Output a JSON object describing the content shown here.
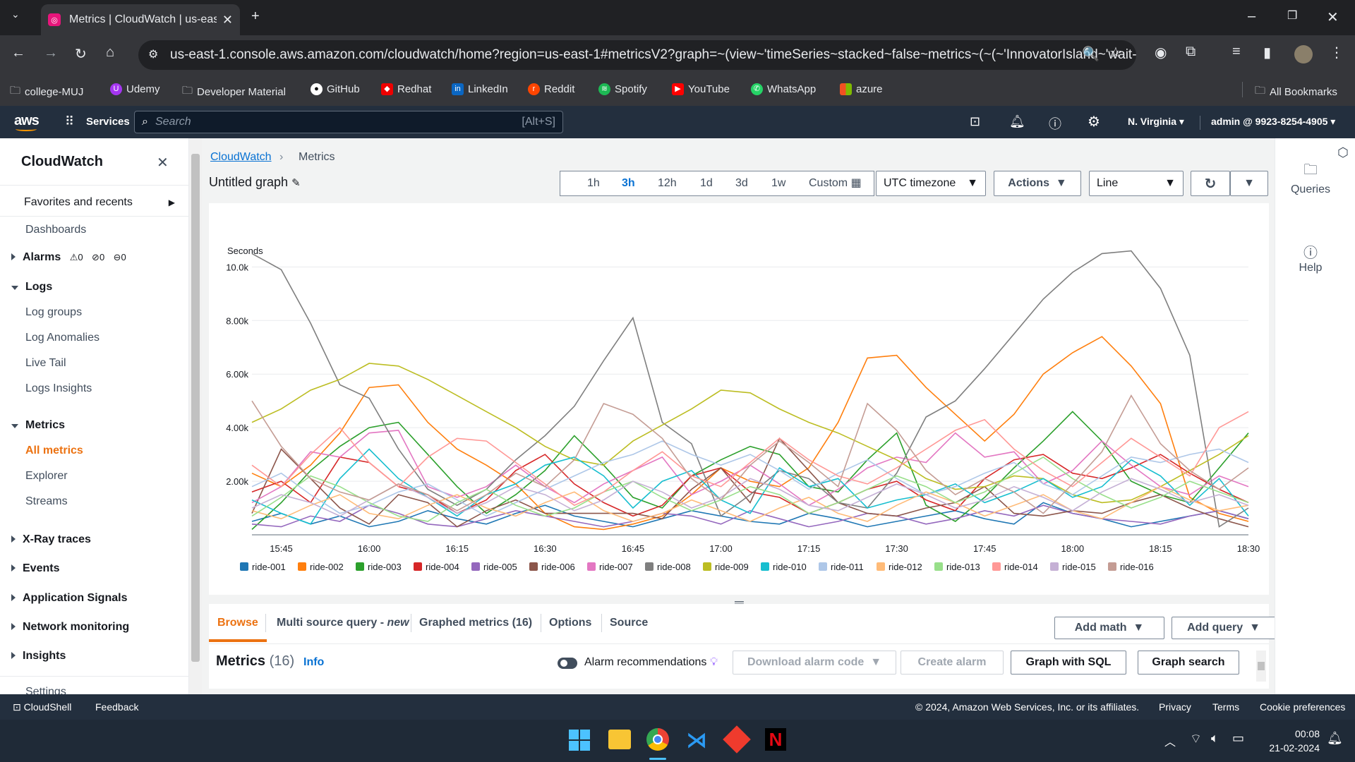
{
  "browser": {
    "tab_title": "Metrics | CloudWatch | us-east-",
    "url": "us-east-1.console.aws.amazon.com/cloudwatch/home?region=us-east-1#metricsV2?graph=~(view~'timeSeries~stacked~false~metrics~(~(~'InnovatorIsland~'wait-...",
    "bookmarks": [
      "college-MUJ",
      "Udemy",
      "Developer Material",
      "GitHub",
      "Redhat",
      "LinkedIn",
      "Reddit",
      "Spotify",
      "YouTube",
      "WhatsApp",
      "azure"
    ],
    "all_bookmarks": "All Bookmarks"
  },
  "aws": {
    "logo": "aws",
    "services": "Services",
    "search_placeholder": "Search",
    "search_shortcut": "[Alt+S]",
    "region": "N. Virginia",
    "account": "admin @ 9923-8254-4905"
  },
  "sidebar": {
    "title": "CloudWatch",
    "favorites": "Favorites and recents",
    "dashboards": "Dashboards",
    "alarms": "Alarms",
    "alarm_counts": [
      "0",
      "0",
      "0"
    ],
    "logs": "Logs",
    "log_items": [
      "Log groups",
      "Log Anomalies",
      "Live Tail",
      "Logs Insights"
    ],
    "metrics": "Metrics",
    "metric_items": [
      "All metrics",
      "Explorer",
      "Streams"
    ],
    "sections": [
      "X-Ray traces",
      "Events",
      "Application Signals",
      "Network monitoring",
      "Insights"
    ],
    "settings": "Settings"
  },
  "main": {
    "breadcrumb_root": "CloudWatch",
    "breadcrumb_current": "Metrics",
    "graph_title": "Untitled graph",
    "time_ranges": [
      "1h",
      "3h",
      "12h",
      "1d",
      "3d",
      "1w"
    ],
    "active_range": "3h",
    "custom": "Custom",
    "timezone": "UTC timezone",
    "actions": "Actions",
    "view": "Line",
    "tabs": [
      "Browse",
      "Multi source query - ",
      "Graphed metrics (16)",
      "Options",
      "Source"
    ],
    "new_label": "new",
    "add_math": "Add math",
    "add_query": "Add query",
    "metrics_label": "Metrics",
    "metrics_count": "(16)",
    "info": "Info",
    "alarm_rec": "Alarm recommendations",
    "download_alarm": "Download alarm code",
    "create_alarm": "Create alarm",
    "graph_sql": "Graph with SQL",
    "graph_search": "Graph search"
  },
  "rail": {
    "queries": "Queries",
    "help": "Help"
  },
  "footer": {
    "cloudshell": "CloudShell",
    "feedback": "Feedback",
    "copyright": "© 2024, Amazon Web Services, Inc. or its affiliates.",
    "privacy": "Privacy",
    "terms": "Terms",
    "cookies": "Cookie preferences"
  },
  "taskbar": {
    "time": "00:08",
    "date": "21-02-2024"
  },
  "chart_data": {
    "type": "line",
    "ylabel": "Seconds",
    "yticks": [
      "2.00k",
      "4.00k",
      "6.00k",
      "8.00k",
      "10.0k"
    ],
    "ylim": [
      0,
      10800
    ],
    "x": [
      "15:40",
      "15:45",
      "15:50",
      "15:55",
      "16:00",
      "16:05",
      "16:10",
      "16:15",
      "16:20",
      "16:25",
      "16:30",
      "16:35",
      "16:40",
      "16:45",
      "16:50",
      "16:55",
      "17:00",
      "17:05",
      "17:10",
      "17:15",
      "17:20",
      "17:25",
      "17:30",
      "17:35",
      "17:40",
      "17:45",
      "17:50",
      "17:55",
      "18:00",
      "18:05",
      "18:10",
      "18:15",
      "18:20",
      "18:25",
      "18:30"
    ],
    "xticks": [
      "15:45",
      "16:00",
      "16:15",
      "16:30",
      "16:45",
      "17:00",
      "17:15",
      "17:30",
      "17:45",
      "18:00",
      "18:15",
      "18:30"
    ],
    "series": [
      {
        "name": "ride-001",
        "color": "#1f77b4",
        "values": [
          500,
          800,
          400,
          700,
          300,
          500,
          900,
          600,
          400,
          800,
          1100,
          700,
          500,
          300,
          600,
          900,
          700,
          500,
          400,
          800,
          600,
          300,
          500,
          700,
          900,
          600,
          400,
          1200,
          800,
          600,
          300,
          500,
          700,
          900,
          600
        ]
      },
      {
        "name": "ride-002",
        "color": "#ff7f0e",
        "values": [
          2300,
          1800,
          2600,
          3800,
          5500,
          5600,
          4200,
          3200,
          2600,
          1900,
          800,
          300,
          200,
          400,
          700,
          1500,
          2500,
          2000,
          1800,
          2500,
          4200,
          6600,
          6700,
          5500,
          4500,
          3500,
          4500,
          6000,
          6800,
          7400,
          6300,
          4900,
          1400,
          800,
          500
        ]
      },
      {
        "name": "ride-003",
        "color": "#2ca02c",
        "values": [
          200,
          1200,
          2400,
          3300,
          4000,
          4200,
          3000,
          1800,
          800,
          1500,
          2400,
          3700,
          2600,
          1400,
          1000,
          2200,
          2800,
          3300,
          3000,
          1800,
          1600,
          2800,
          3800,
          1100,
          500,
          1400,
          2500,
          3500,
          4600,
          3500,
          2000,
          1500,
          1200,
          2500,
          3800
        ]
      },
      {
        "name": "ride-004",
        "color": "#d62728",
        "values": [
          1600,
          2000,
          1200,
          2900,
          2700,
          1800,
          1500,
          800,
          1300,
          2400,
          3000,
          1900,
          1200,
          700,
          1100,
          2200,
          2500,
          1600,
          1400,
          800,
          1200,
          1700,
          2000,
          1300,
          900,
          2100,
          2800,
          3000,
          2300,
          2100,
          2500,
          3000,
          2300,
          1700,
          1200
        ]
      },
      {
        "name": "ride-005",
        "color": "#9467bd",
        "values": [
          400,
          300,
          700,
          500,
          1100,
          800,
          400,
          300,
          600,
          900,
          700,
          500,
          300,
          500,
          800,
          700,
          400,
          900,
          600,
          300,
          500,
          800,
          700,
          400,
          600,
          900,
          700,
          1100,
          800,
          600,
          500,
          400,
          700,
          900,
          600
        ]
      },
      {
        "name": "ride-006",
        "color": "#8c564b",
        "values": [
          800,
          3200,
          2100,
          1000,
          400,
          1500,
          1200,
          300,
          900,
          1300,
          800,
          800,
          800,
          800,
          600,
          1700,
          2500,
          1200,
          3600,
          2400,
          1200,
          800,
          700,
          1000,
          1200,
          1800,
          800,
          700,
          900,
          800,
          1200,
          1500,
          1000,
          600,
          300
        ]
      },
      {
        "name": "ride-007",
        "color": "#e377c2",
        "values": [
          1200,
          1800,
          3100,
          2900,
          3800,
          3900,
          1800,
          1400,
          1800,
          2600,
          1800,
          1200,
          1900,
          2400,
          2900,
          1500,
          2000,
          2600,
          1900,
          1100,
          1700,
          2500,
          2900,
          2700,
          3800,
          2900,
          3100,
          1900,
          2400,
          3500,
          2600,
          1800,
          1500,
          2200,
          1800
        ]
      },
      {
        "name": "ride-008",
        "color": "#7f7f7f",
        "values": [
          10500,
          9900,
          7900,
          5600,
          5100,
          3200,
          1700,
          1100,
          1700,
          2800,
          3700,
          4800,
          6500,
          8100,
          4200,
          3400,
          700,
          1500,
          2400,
          2100,
          1200,
          1000,
          2300,
          4400,
          5000,
          6200,
          7500,
          8800,
          9800,
          10500,
          10600,
          9200,
          6700,
          300,
          1000
        ]
      },
      {
        "name": "ride-009",
        "color": "#bcbd22",
        "values": [
          4200,
          4700,
          5400,
          5800,
          6400,
          6300,
          5800,
          5200,
          4600,
          4000,
          3300,
          2800,
          2600,
          3500,
          4100,
          4700,
          5400,
          5300,
          4700,
          4200,
          3800,
          3300,
          2800,
          2100,
          1700,
          1800,
          2200,
          2100,
          1500,
          1200,
          1300,
          1800,
          2400,
          3000,
          3700
        ]
      },
      {
        "name": "ride-010",
        "color": "#17becf",
        "values": [
          1300,
          800,
          400,
          2100,
          3200,
          2100,
          1400,
          700,
          1500,
          1900,
          2600,
          2900,
          2200,
          1000,
          2000,
          2400,
          1300,
          800,
          2500,
          1800,
          2100,
          1000,
          1300,
          1500,
          1900,
          1200,
          1600,
          2100,
          1400,
          1800,
          2800,
          2200,
          1100,
          2100,
          700
        ]
      },
      {
        "name": "ride-011",
        "color": "#aec7e8",
        "values": [
          1800,
          2300,
          1500,
          800,
          1100,
          1600,
          1900,
          1300,
          700,
          1200,
          1700,
          2200,
          2700,
          3000,
          3500,
          3000,
          2600,
          3000,
          2400,
          1700,
          2300,
          2800,
          2100,
          1500,
          1800,
          2300,
          2700,
          1900,
          1500,
          2200,
          2900,
          2700,
          3000,
          3200,
          2700
        ]
      },
      {
        "name": "ride-012",
        "color": "#ffbb78",
        "values": [
          900,
          600,
          1100,
          1500,
          800,
          600,
          1100,
          1500,
          1000,
          700,
          1200,
          1600,
          900,
          500,
          800,
          1300,
          900,
          500,
          1000,
          1400,
          800,
          500,
          1100,
          1600,
          1200,
          700,
          1100,
          1500,
          900,
          600,
          1200,
          1800,
          1300,
          900,
          1100
        ]
      },
      {
        "name": "ride-013",
        "color": "#98df8a",
        "values": [
          700,
          1400,
          2200,
          1800,
          1200,
          700,
          500,
          1200,
          1700,
          1100,
          700,
          1000,
          1600,
          2000,
          1400,
          900,
          1300,
          1800,
          1500,
          800,
          1200,
          1700,
          2200,
          1800,
          1200,
          1600,
          2300,
          2900,
          2100,
          1500,
          1000,
          1400,
          2000,
          1600,
          1200
        ]
      },
      {
        "name": "ride-014",
        "color": "#ff9896",
        "values": [
          2600,
          1800,
          3000,
          4000,
          2700,
          1800,
          2900,
          3600,
          3500,
          2700,
          1900,
          1100,
          1600,
          2400,
          3100,
          2200,
          1800,
          2700,
          3600,
          2800,
          2200,
          1900,
          2500,
          3200,
          3900,
          4300,
          3200,
          2400,
          1800,
          2700,
          3600,
          2900,
          2200,
          4000,
          4600
        ]
      },
      {
        "name": "ride-015",
        "color": "#c5b0d5",
        "values": [
          1000,
          1500,
          1200,
          700,
          1300,
          1900,
          1400,
          800,
          1200,
          1800,
          1500,
          900,
          1300,
          2000,
          1600,
          1000,
          1400,
          2100,
          1700,
          1100,
          900,
          1400,
          1900,
          1500,
          1000,
          1300,
          1800,
          1400,
          900,
          1600,
          2100,
          1700,
          1200,
          1500,
          1100
        ]
      },
      {
        "name": "ride-016",
        "color": "#c49c94",
        "values": [
          5000,
          3300,
          2100,
          1600,
          1300,
          1900,
          1500,
          900,
          1500,
          2300,
          1800,
          2800,
          4900,
          4500,
          3600,
          2100,
          1300,
          2600,
          3500,
          2700,
          1800,
          4900,
          3900,
          2400,
          1500,
          2100,
          1600,
          800,
          1900,
          3100,
          5200,
          3400,
          2400,
          1700,
          2500
        ]
      }
    ]
  }
}
